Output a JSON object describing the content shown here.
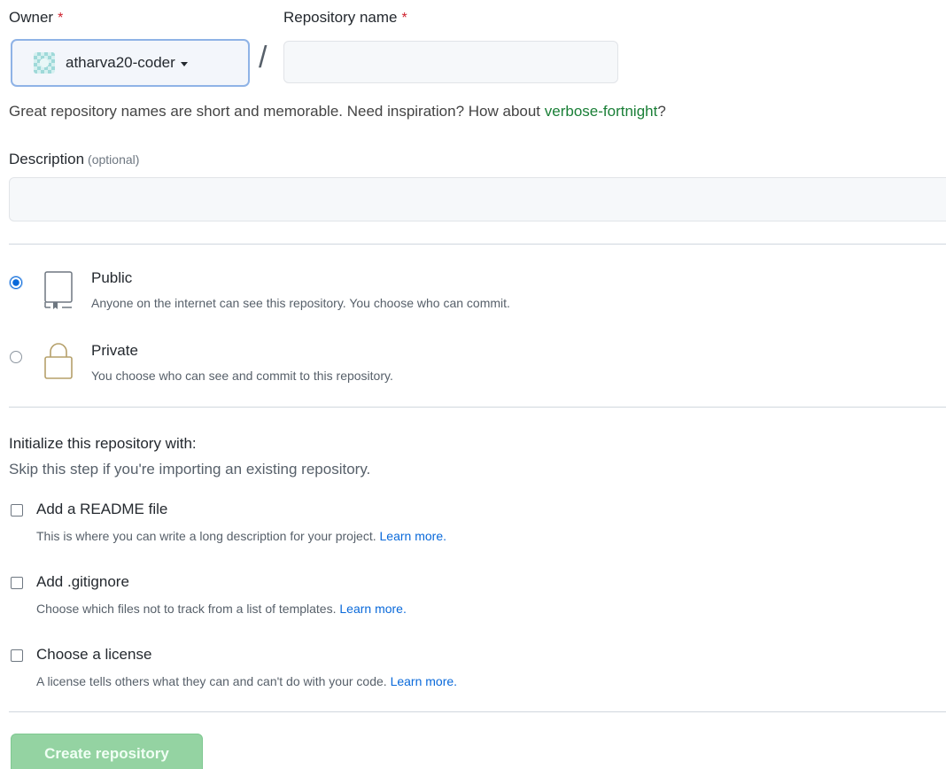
{
  "owner": {
    "label": "Owner",
    "required_mark": "*",
    "selected": "atharva20-coder"
  },
  "repo": {
    "label": "Repository name",
    "required_mark": "*",
    "separator": "/",
    "value": "",
    "placeholder": ""
  },
  "hint": {
    "text": "Great repository names are short and memorable. Need inspiration? How about ",
    "suggestion": "verbose-fortnight",
    "end": "?"
  },
  "description": {
    "label": "Description",
    "optional": "(optional)",
    "value": ""
  },
  "visibility": {
    "selected": "public",
    "options": [
      {
        "title": "Public",
        "desc": "Anyone on the internet can see this repository. You choose who can commit.",
        "icon": "repo-icon"
      },
      {
        "title": "Private",
        "desc": "You choose who can see and commit to this repository.",
        "icon": "lock-icon"
      }
    ]
  },
  "init": {
    "title": "Initialize this repository with:",
    "subtitle": "Skip this step if you're importing an existing repository.",
    "items": [
      {
        "title": "Add a README file",
        "desc": "This is where you can write a long description for your project.",
        "link": "Learn more.",
        "checked": false
      },
      {
        "title": "Add .gitignore",
        "desc": "Choose which files not to track from a list of templates.",
        "link": "Learn more.",
        "checked": false
      },
      {
        "title": "Choose a license",
        "desc": "A license tells others what they can and can't do with your code.",
        "link": "Learn more.",
        "checked": false
      }
    ]
  },
  "submit": {
    "label": "Create repository"
  },
  "colors": {
    "link": "#0969da",
    "suggestion": "#1a7f37",
    "required": "#cf222e",
    "button_disabled": "#94d3a2"
  }
}
